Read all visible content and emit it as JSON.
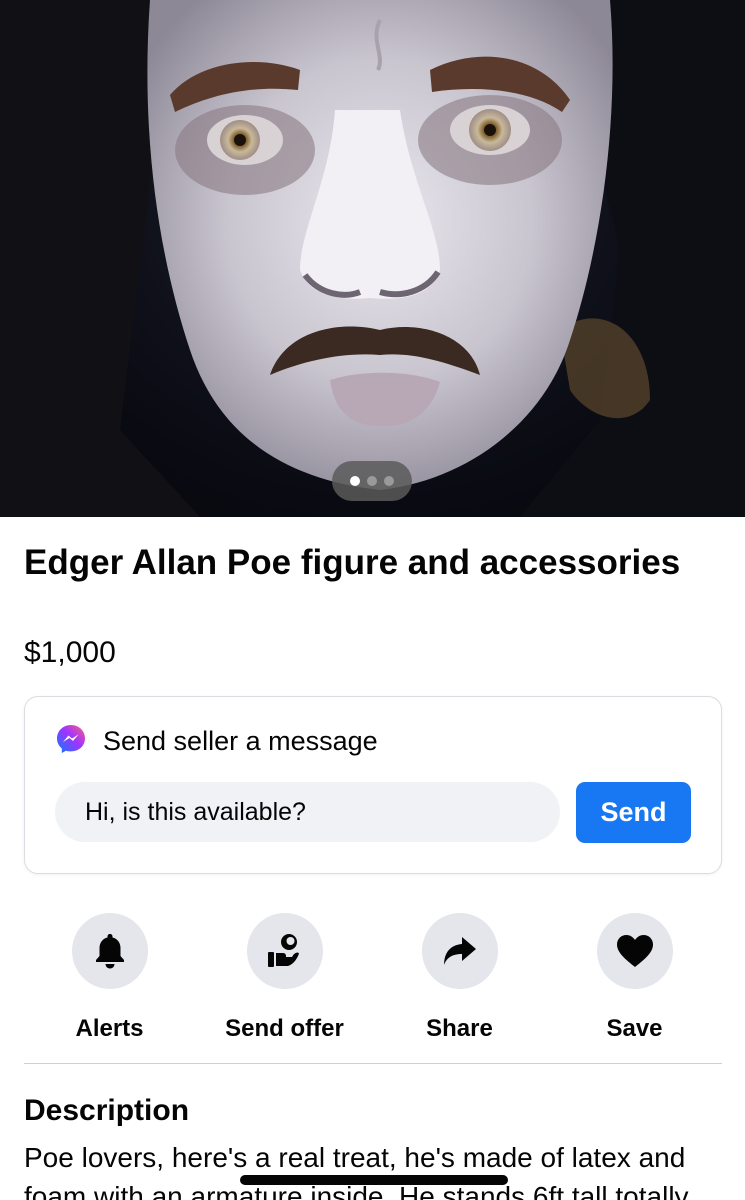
{
  "listing": {
    "title": "Edger Allan Poe figure and accessories",
    "price": "$1,000",
    "photo": {
      "alt": "",
      "pager_dots": 3,
      "active_dot": 1
    }
  },
  "message_card": {
    "icon": "messenger-icon",
    "label": "Send seller a message",
    "input_value": "Hi, is this available?",
    "send_label": "Send"
  },
  "actions": [
    {
      "label": "Alerts",
      "icon": "bell-icon"
    },
    {
      "label": "Send offer",
      "icon": "offer-hand-icon"
    },
    {
      "label": "Share",
      "icon": "share-arrow-icon"
    },
    {
      "label": "Save",
      "icon": "heart-icon"
    }
  ],
  "description": {
    "heading": "Description",
    "text": "Poe lovers, here's a real treat, he's made of  latex and foam with an armature inside. He stands 6ft tall totally"
  },
  "colors": {
    "accent": "#1877f2",
    "chip_bg": "#e4e6eb",
    "input_bg": "#f0f2f5",
    "text": "#050505"
  }
}
